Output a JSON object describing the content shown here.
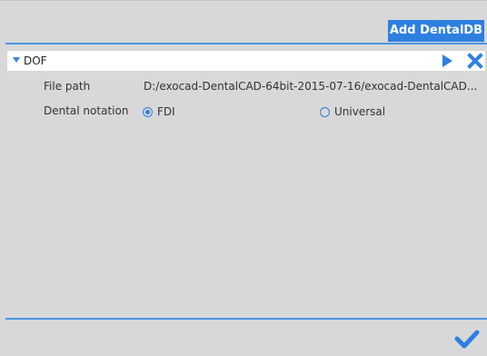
{
  "toolbar": {
    "add_label": "Add DentalDB"
  },
  "database": {
    "name": "DOF",
    "file_path_label": "File path",
    "file_path_value": "D:/exocad-DentalCAD-64bit-2015-07-16/exocad-DentalCAD...",
    "notation_label": "Dental notation",
    "notation_options": [
      {
        "label": "FDI",
        "selected": true
      },
      {
        "label": "Universal",
        "selected": false
      }
    ]
  },
  "colors": {
    "accent": "#2e7fe0",
    "panel_bg": "#d8d8d8"
  },
  "icons": {
    "expand": "caret-down-icon",
    "run": "play-icon",
    "remove": "close-icon",
    "confirm": "checkmark-icon"
  }
}
